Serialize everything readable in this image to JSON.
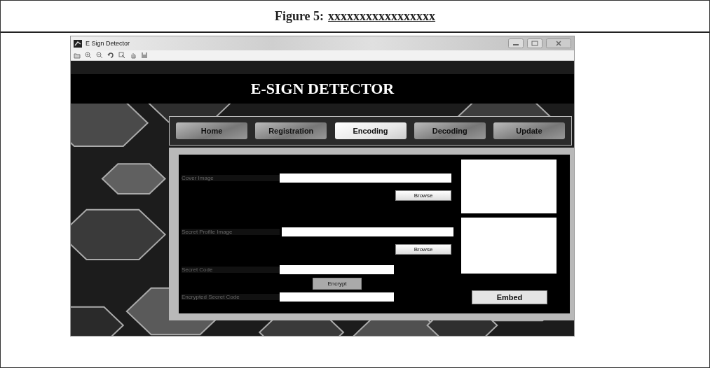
{
  "caption": {
    "label": "Figure 5:",
    "title": "xxxxxxxxxxxxxxxxx"
  },
  "window": {
    "title": "E Sign Detector"
  },
  "app_title": "E-SIGN DETECTOR",
  "tabs": [
    {
      "label": "Home",
      "selected": false
    },
    {
      "label": "Registration",
      "selected": false
    },
    {
      "label": "Encoding",
      "selected": true
    },
    {
      "label": "Decoding",
      "selected": false
    },
    {
      "label": "Update",
      "selected": false
    }
  ],
  "fields": [
    {
      "label": "Cover Image",
      "kind": "wide",
      "button": "Browse"
    },
    {
      "label": "Secret Profile Image",
      "kind": "wide",
      "button": "Browse"
    },
    {
      "label": "Secret Code",
      "kind": "short",
      "button": "Encrypt"
    },
    {
      "label": "Encrypted Secret Code",
      "kind": "short"
    }
  ],
  "embed_button": "Embed"
}
